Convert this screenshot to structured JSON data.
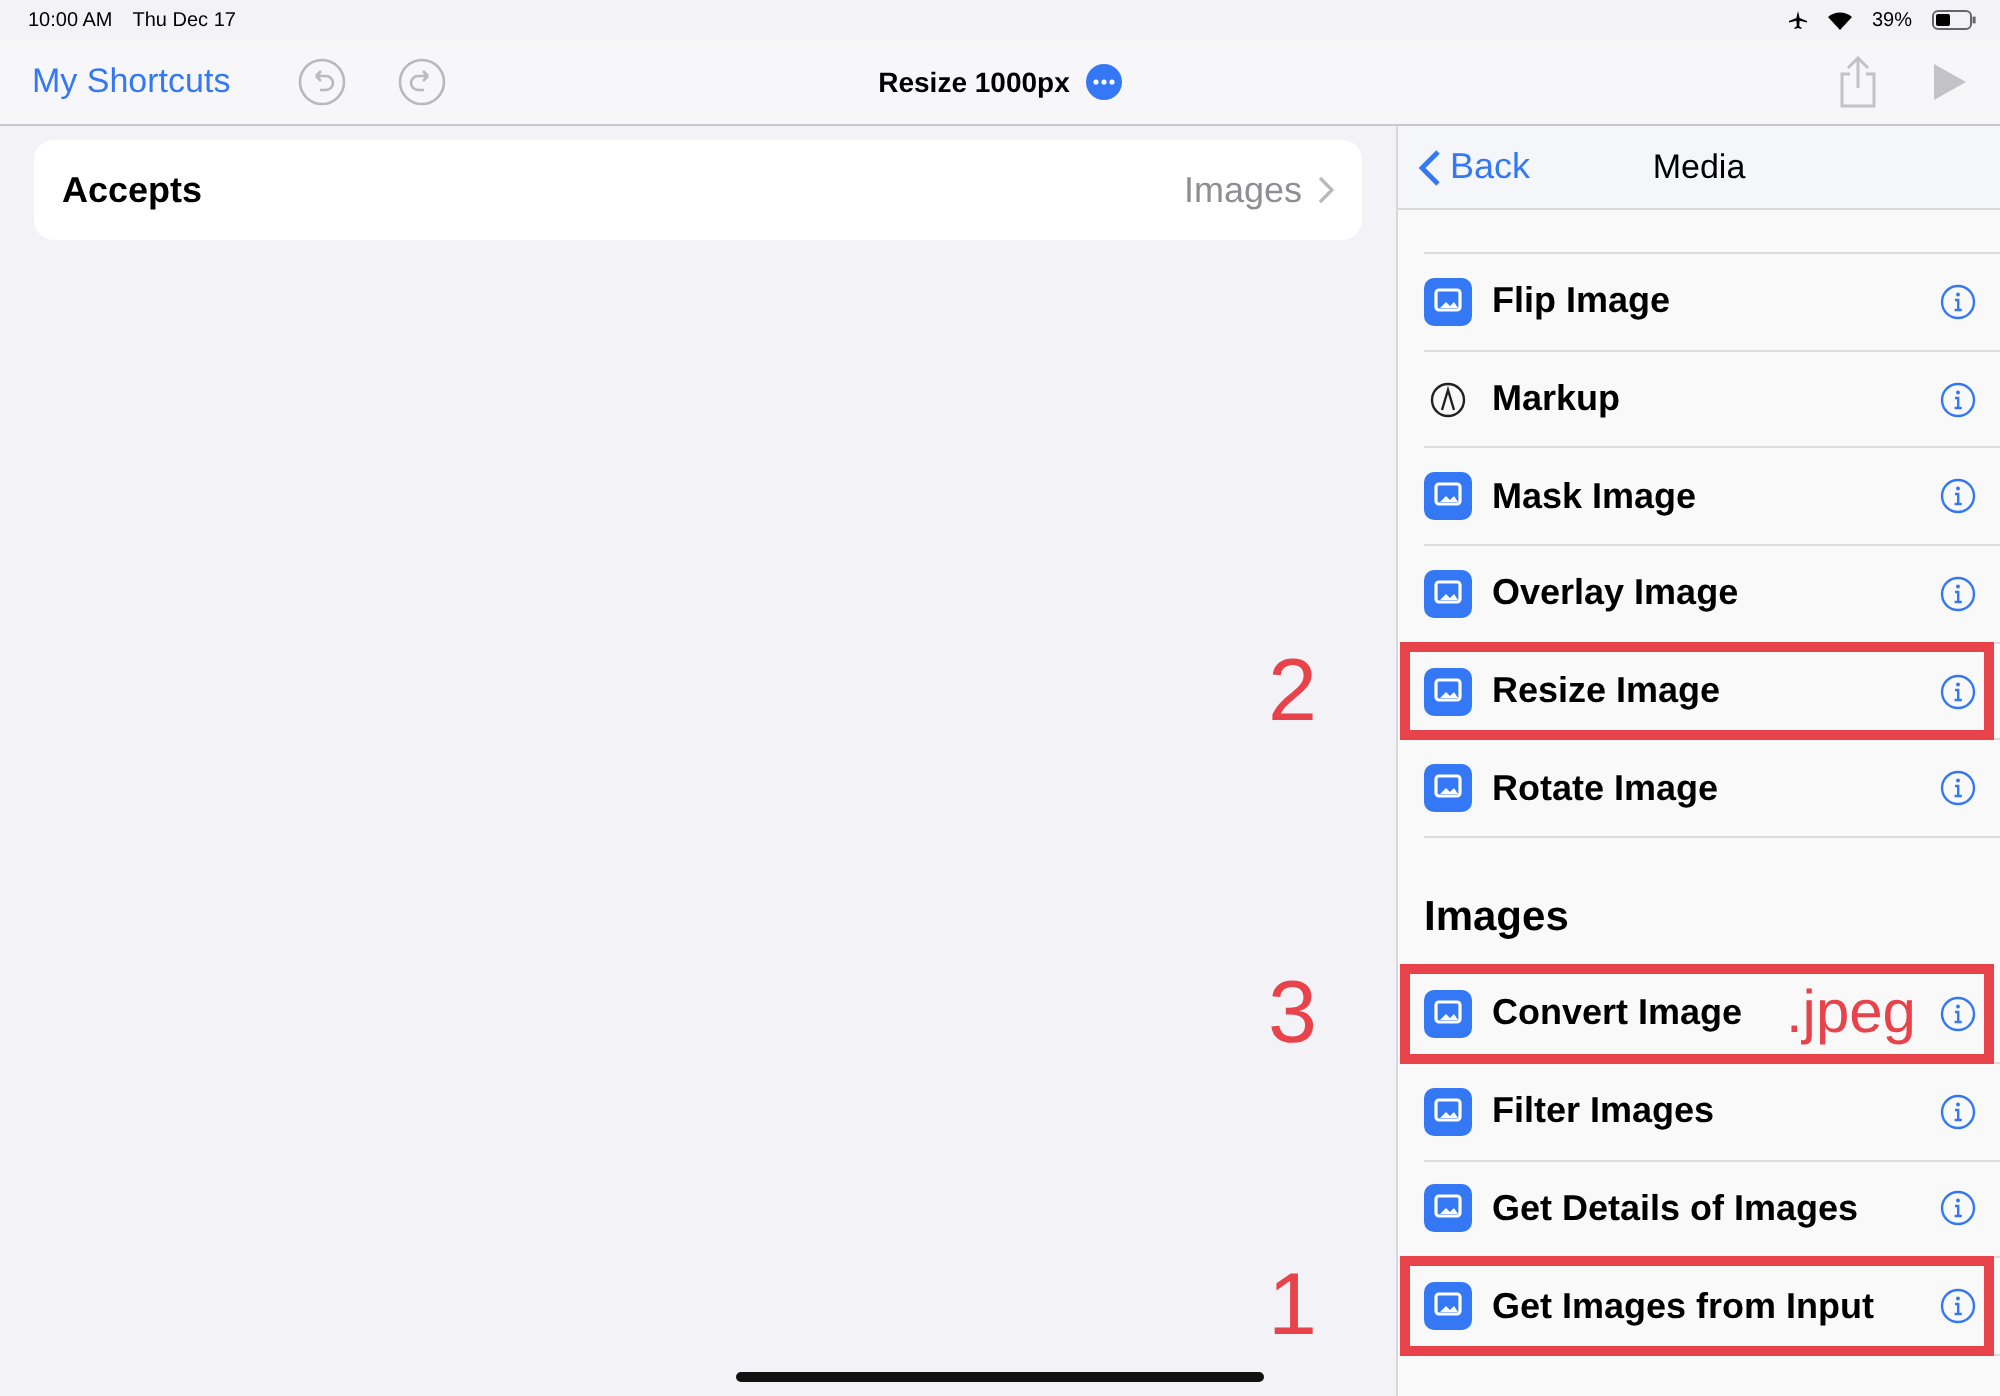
{
  "status_bar": {
    "time": "10:00 AM",
    "date": "Thu Dec 17",
    "battery": "39%"
  },
  "toolbar": {
    "back_link": "My Shortcuts",
    "title": "Resize 1000px"
  },
  "accepts": {
    "label": "Accepts",
    "value": "Images"
  },
  "panel": {
    "back": "Back",
    "title": "Media",
    "sections": [
      {
        "items": [
          {
            "label": "Flip Image",
            "kind": "image"
          },
          {
            "label": "Markup",
            "kind": "markup"
          },
          {
            "label": "Mask Image",
            "kind": "image"
          },
          {
            "label": "Overlay Image",
            "kind": "image"
          },
          {
            "label": "Resize Image",
            "kind": "image",
            "highlighted": true,
            "marker": "2"
          },
          {
            "label": "Rotate Image",
            "kind": "image"
          }
        ]
      },
      {
        "heading": "Images",
        "items": [
          {
            "label": "Convert Image",
            "kind": "image",
            "highlighted": true,
            "marker": "3",
            "note": ".jpeg"
          },
          {
            "label": "Filter Images",
            "kind": "image"
          },
          {
            "label": "Get Details of Images",
            "kind": "image"
          },
          {
            "label": "Get Images from Input",
            "kind": "image",
            "highlighted": true,
            "marker": "1"
          }
        ]
      }
    ]
  }
}
